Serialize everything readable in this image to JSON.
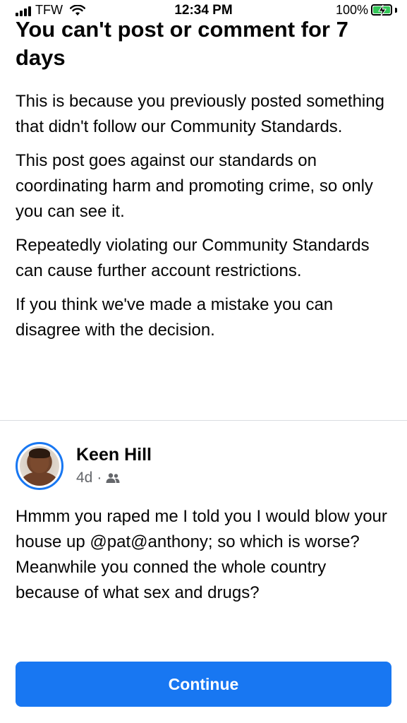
{
  "status_bar": {
    "carrier": "TFW",
    "time": "12:34 PM",
    "battery": "100%"
  },
  "notice": {
    "title": "You can't post or comment for 7 days",
    "paragraphs": [
      "This is because you previously posted something that didn't follow our Community Standards.",
      "This post goes against our standards on coordinating harm and promoting crime, so only you can see it.",
      "Repeatedly violating our Community Standards can cause further account restrictions.",
      "If you think we've made a mistake you can disagree with the decision."
    ]
  },
  "post": {
    "author": "Keen Hill",
    "time_ago": "4d",
    "separator": "·",
    "audience_icon": "friends-icon",
    "text": "Hmmm you raped me I told you I would blow your house up @pat@anthony; so which is worse?  Meanwhile you conned the whole country because of what sex and drugs?"
  },
  "actions": {
    "continue_label": "Continue"
  },
  "colors": {
    "accent": "#1877f2",
    "meta_text": "#65676b",
    "divider": "#dadde1",
    "battery": "#35c759"
  }
}
